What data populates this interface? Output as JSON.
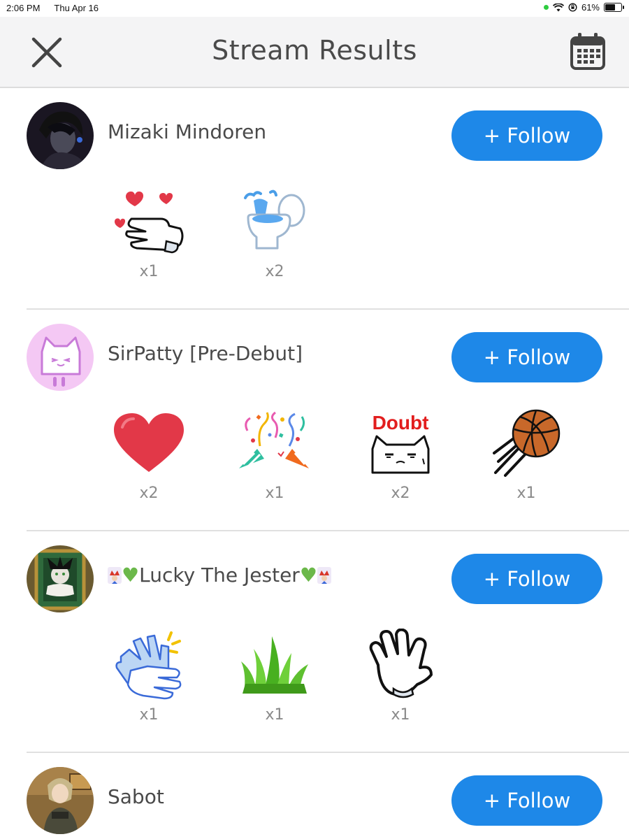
{
  "status": {
    "time": "2:06 PM",
    "date": "Thu Apr 16",
    "battery": "61%"
  },
  "header": {
    "title": "Stream Results"
  },
  "users": [
    {
      "name": "Mizaki Mindoren",
      "follow_label": "+ Follow",
      "gifts": [
        {
          "icon": "hearts-hand-icon",
          "count": "x1"
        },
        {
          "icon": "toilet-icon",
          "count": "x2"
        }
      ]
    },
    {
      "name": "SirPatty [Pre-Debut]",
      "follow_label": "+ Follow",
      "gifts": [
        {
          "icon": "heart-icon",
          "count": "x2"
        },
        {
          "icon": "party-popper-icon",
          "count": "x1"
        },
        {
          "icon": "doubt-cat-icon",
          "count": "x2",
          "label": "Doubt"
        },
        {
          "icon": "basketball-icon",
          "count": "x1"
        }
      ]
    },
    {
      "name_text": "Lucky The Jester",
      "follow_label": "+ Follow",
      "gifts": [
        {
          "icon": "clapping-hands-icon",
          "count": "x1"
        },
        {
          "icon": "grass-icon",
          "count": "x1"
        },
        {
          "icon": "waving-hand-icon",
          "count": "x1"
        }
      ]
    },
    {
      "name": "Sabot",
      "follow_label": "+ Follow",
      "gifts": []
    }
  ],
  "colors": {
    "follow": "#1e88e8",
    "header_bg": "#f4f4f5"
  }
}
